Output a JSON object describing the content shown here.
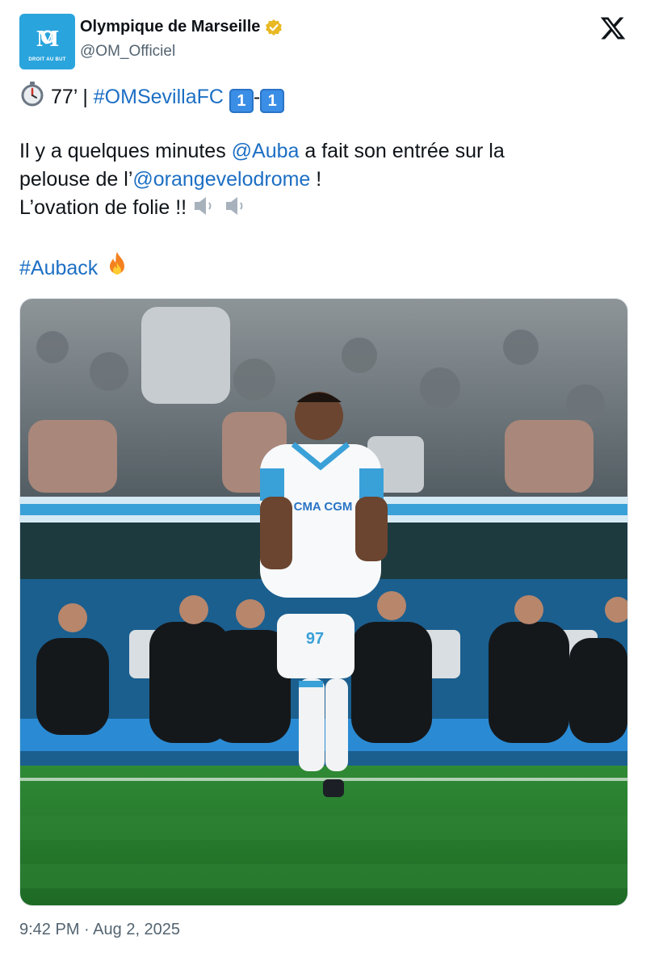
{
  "account": {
    "display_name": "Olympique de Marseille",
    "handle": "@OM_Officiel",
    "avatar_motto": "DROIT AU BUT",
    "avatar_color": "#2aa4dd",
    "verified_color": "#e8b923"
  },
  "tweet": {
    "minute": "77’ |",
    "match_hashtag": "#OMSevillaFC",
    "score_home": "1",
    "score_sep": "-",
    "score_away": "1",
    "line1_pre": "Il y a quelques minutes ",
    "mention_player": "@Auba",
    "line1_post": " a fait son entrée sur la",
    "line2_pre": "pelouse de l’",
    "mention_stadium": "@orangevelodrome",
    "line2_post": " !",
    "line3": "L’ovation de folie !!",
    "hashtag": "#Auback",
    "link_color": "#1d6fc4"
  },
  "media": {
    "shirt_sponsor": "CMA CGM",
    "shirt_number": "97"
  },
  "meta": {
    "time": "9:42 PM",
    "separator": "·",
    "date": "Aug 2, 2025"
  },
  "icons": {
    "logo": "x-logo-icon",
    "verified": "verified-badge-icon",
    "stopwatch": "stopwatch-icon",
    "speaker": "speaker-icon",
    "fire": "fire-icon"
  }
}
